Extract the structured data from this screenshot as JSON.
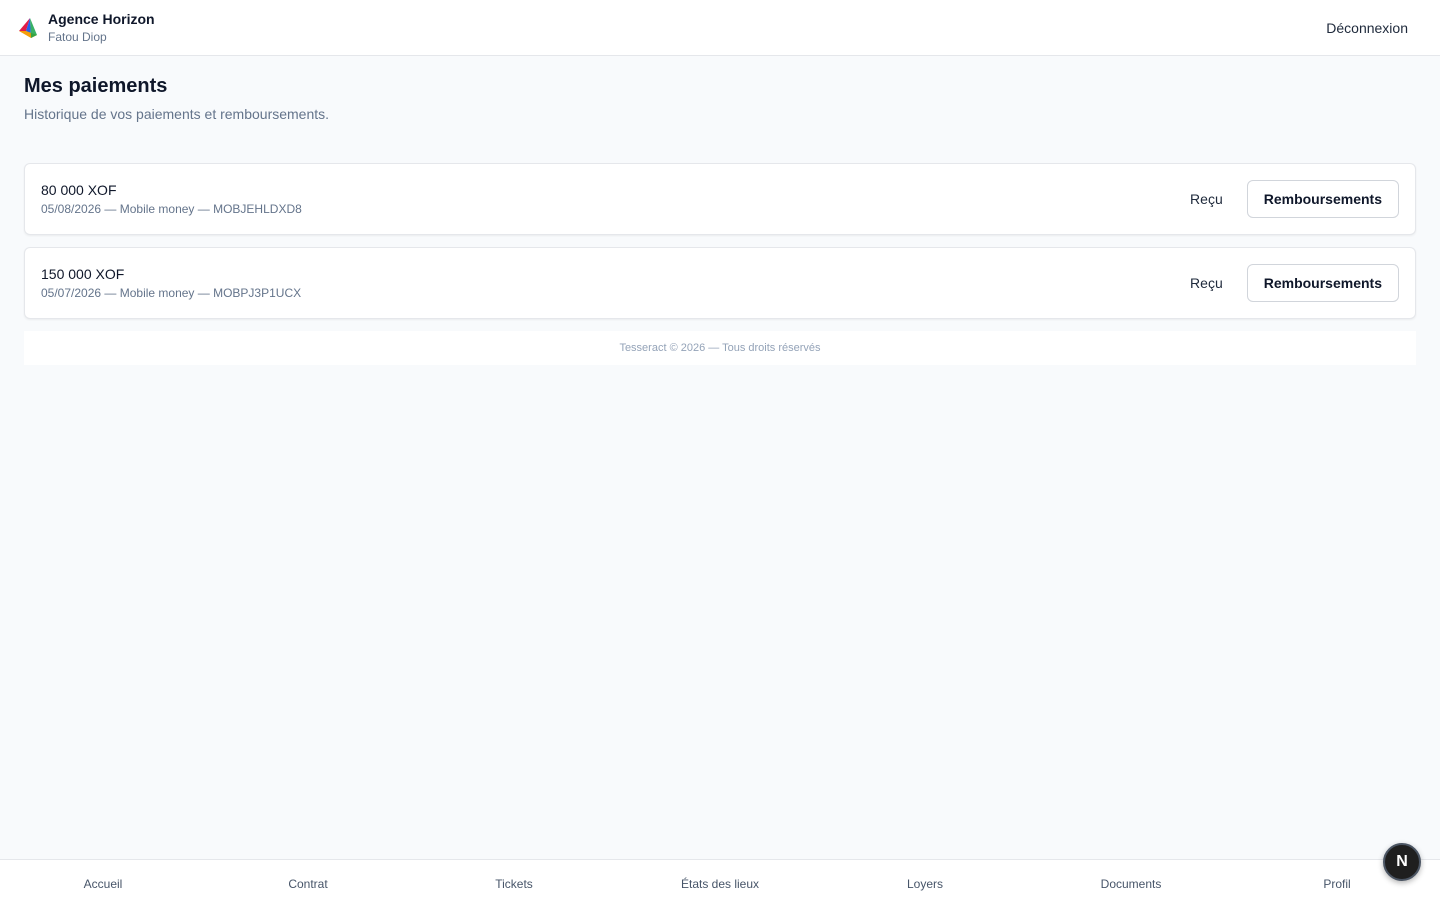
{
  "header": {
    "brand_name": "Agence Horizon",
    "user_name": "Fatou Diop",
    "logout_label": "Déconnexion",
    "logo_icon": "agency-logo-icon",
    "logo_colors": [
      "#e11d48",
      "#2563eb",
      "#f59e0b",
      "#16a34a"
    ]
  },
  "page": {
    "title": "Mes paiements",
    "subtitle": "Historique de vos paiements et remboursements."
  },
  "payments": [
    {
      "amount": "80 000 XOF",
      "meta": "05/08/2026 — Mobile money — MOBJEHLDXD8",
      "receipt_label": "Reçu",
      "refunds_label": "Remboursements"
    },
    {
      "amount": "150 000 XOF",
      "meta": "05/07/2026 — Mobile money — MOBPJ3P1UCX",
      "receipt_label": "Reçu",
      "refunds_label": "Remboursements"
    }
  ],
  "footer": {
    "text": "Tesseract © 2026 — Tous droits réservés"
  },
  "bottom_nav": [
    {
      "label": "Accueil"
    },
    {
      "label": "Contrat"
    },
    {
      "label": "Tickets"
    },
    {
      "label": "États des lieux"
    },
    {
      "label": "Loyers"
    },
    {
      "label": "Documents"
    },
    {
      "label": "Profil"
    }
  ],
  "fab": {
    "label": "N",
    "icon": "nextjs-dev-icon"
  }
}
